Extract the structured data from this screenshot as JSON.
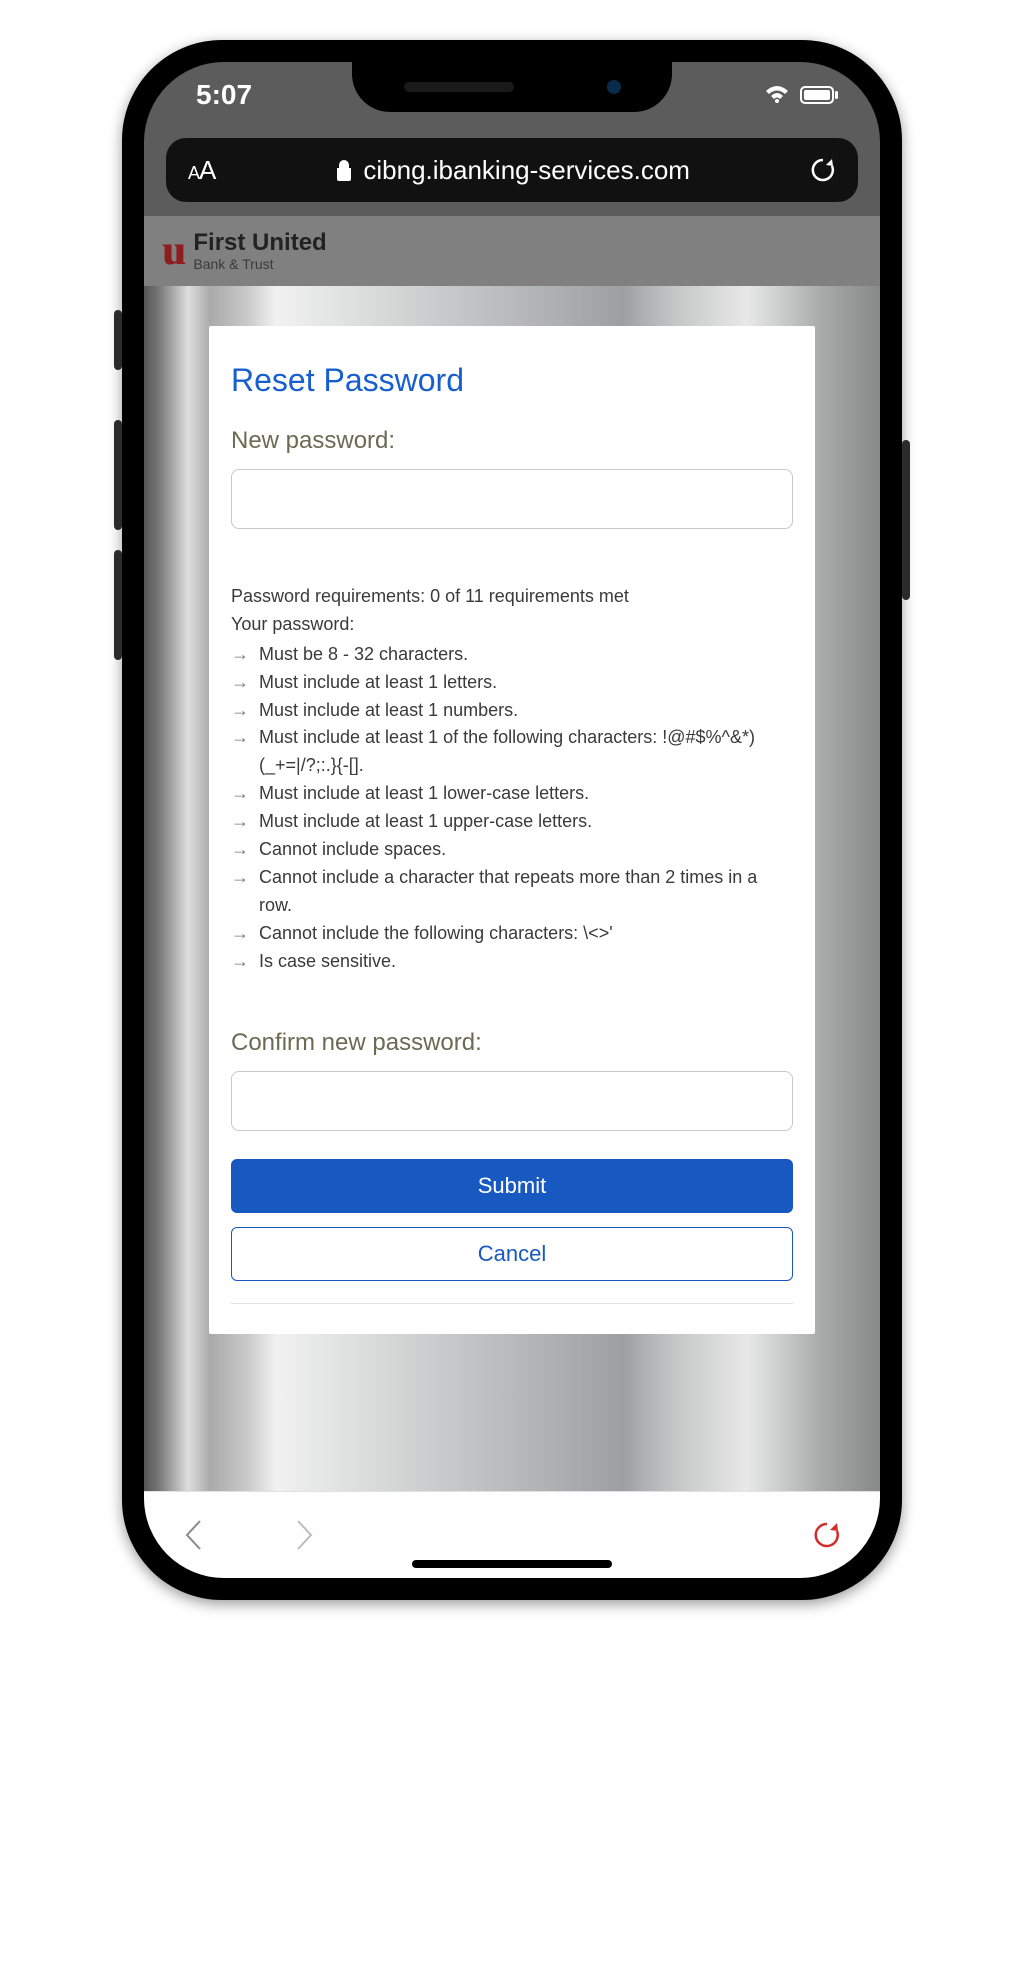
{
  "status": {
    "time": "5:07"
  },
  "browser": {
    "url": "cibng.ibanking-services.com"
  },
  "bank": {
    "name_line1": "First United",
    "name_line2": "Bank & Trust"
  },
  "form": {
    "title": "Reset Password",
    "new_password_label": "New password:",
    "confirm_label": "Confirm new password:",
    "submit_label": "Submit",
    "cancel_label": "Cancel",
    "req_summary": "Password requirements: 0 of 11 requirements met",
    "req_intro": "Your password:",
    "requirements": [
      "Must be 8 - 32 characters.",
      "Must include at least 1 letters.",
      "Must include at least 1 numbers.",
      "Must include at least 1 of the following characters: !@#$%^&*)(_+=|/?;:.}{-[].",
      "Must include at least 1 lower-case letters.",
      "Must include at least 1 upper-case letters.",
      "Cannot include spaces.",
      "Cannot include a character that repeats more than 2 times in a row.",
      "Cannot include the following characters: \\<>'",
      "Is case sensitive."
    ]
  }
}
